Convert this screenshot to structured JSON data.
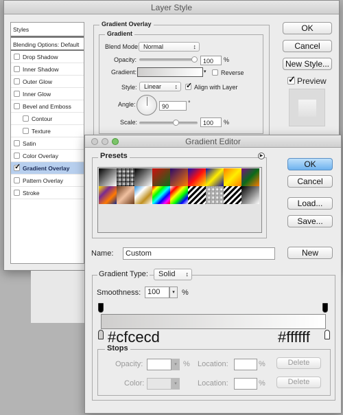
{
  "layer_style": {
    "title": "Layer Style",
    "sidebar": {
      "header": "Styles",
      "blending": "Blending Options: Default",
      "items": [
        {
          "label": "Drop Shadow",
          "checked": false,
          "indent": false
        },
        {
          "label": "Inner Shadow",
          "checked": false,
          "indent": false
        },
        {
          "label": "Outer Glow",
          "checked": false,
          "indent": false
        },
        {
          "label": "Inner Glow",
          "checked": false,
          "indent": false
        },
        {
          "label": "Bevel and Emboss",
          "checked": false,
          "indent": false
        },
        {
          "label": "Contour",
          "checked": false,
          "indent": true
        },
        {
          "label": "Texture",
          "checked": false,
          "indent": true
        },
        {
          "label": "Satin",
          "checked": false,
          "indent": false
        },
        {
          "label": "Color Overlay",
          "checked": false,
          "indent": false
        },
        {
          "label": "Gradient Overlay",
          "checked": true,
          "indent": false,
          "selected": true
        },
        {
          "label": "Pattern Overlay",
          "checked": false,
          "indent": false
        },
        {
          "label": "Stroke",
          "checked": false,
          "indent": false
        }
      ]
    },
    "panel": {
      "section": "Gradient Overlay",
      "group": "Gradient",
      "blend_mode_label": "Blend Mode:",
      "blend_mode": "Normal",
      "opacity_label": "Opacity:",
      "opacity": "100",
      "opacity_percent": 100,
      "pct": "%",
      "gradient_label": "Gradient:",
      "reverse_label": "Reverse",
      "reverse": false,
      "style_label": "Style:",
      "style": "Linear",
      "align_label": "Align with Layer",
      "align": true,
      "angle_label": "Angle:",
      "angle": "90",
      "degree": "°",
      "scale_label": "Scale:",
      "scale": "100",
      "scale_percent": 100
    },
    "buttons": {
      "ok": "OK",
      "cancel": "Cancel",
      "new_style": "New Style...",
      "preview": "Preview",
      "preview_checked": true
    }
  },
  "gradient_editor": {
    "title": "Gradient Editor",
    "presets_label": "Presets",
    "presets": [
      [
        "#000",
        "#fff"
      ],
      [
        "#000",
        "transparent"
      ],
      [
        "#000",
        "#fff"
      ],
      [
        "#d01010",
        "#0a6a1a"
      ],
      [
        "#2a0a6a",
        "#ff7a00"
      ],
      [
        "#1010b0",
        "#ff1010",
        "#ffee00"
      ],
      [
        "#1010a0",
        "#ffee00",
        "#1010a0"
      ],
      [
        "#ff7a00",
        "#ffee00",
        "#ff7a00"
      ],
      [
        "#7a1080",
        "#0a6a1a",
        "#ff7a00"
      ],
      [
        "#ffe000",
        "#7a2a90",
        "#ff7a00",
        "#102a90"
      ],
      [
        "#6a3a1a",
        "#f0c0a0",
        "#6a3a1a"
      ],
      [
        "#2a90e0",
        "#fff",
        "#c09020",
        "#fff"
      ],
      [
        "#ff0000",
        "#ffff00",
        "#00ff00",
        "#00ffff",
        "#0000ff",
        "#ff00ff",
        "#ff0000"
      ],
      [
        "#fff",
        "#ff0000",
        "#ffff00",
        "#00ff00",
        "#0000ff",
        "#fff"
      ],
      [
        "stripes-bw"
      ],
      [
        "#888",
        "transparent"
      ],
      [
        "stripes-bw"
      ],
      [
        "#000",
        "#fff"
      ]
    ],
    "name_label": "Name:",
    "name": "Custom",
    "buttons": {
      "ok": "OK",
      "cancel": "Cancel",
      "load": "Load...",
      "save": "Save...",
      "new": "New"
    },
    "gradient_type_label": "Gradient Type:",
    "gradient_type": "Solid",
    "smoothness_label": "Smoothness:",
    "smoothness": "100",
    "pct": "%",
    "start_color": "#cfcecd",
    "end_color": "#ffffff",
    "stops": {
      "label": "Stops",
      "opacity_label": "Opacity:",
      "color_label": "Color:",
      "location_label": "Location:",
      "pct": "%",
      "delete": "Delete"
    }
  }
}
